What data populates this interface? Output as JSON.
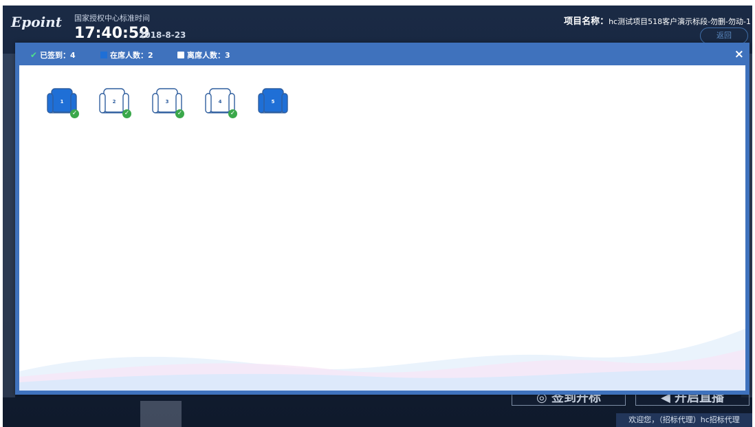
{
  "header": {
    "logo": "Epoint",
    "time_label": "国家授权中心标准时间",
    "time": "17:40:59",
    "date": "2018-8-23",
    "project_label": "项目名称：",
    "project_name": "hc测试项目518客户演示标段-勿删-勿动-1",
    "back_label": "返回"
  },
  "footer": {
    "btn_left": "◎ 签到开标",
    "btn_right": "◀ 开启直播",
    "welcome": "欢迎您，（招标代理）hc招标代理"
  },
  "modal": {
    "legend": {
      "signed_label": "已签到：4",
      "present_label": "在席人数：2",
      "absent_label": "离席人数：3"
    },
    "close_icon": "×"
  },
  "seats": [
    {
      "number": "1",
      "status": "present",
      "signed": true
    },
    {
      "number": "2",
      "status": "absent",
      "signed": true
    },
    {
      "number": "3",
      "status": "absent",
      "signed": true
    },
    {
      "number": "4",
      "status": "absent",
      "signed": true
    },
    {
      "number": "5",
      "status": "present",
      "signed": false
    }
  ],
  "colors": {
    "modal_header": "#3f72bd",
    "seat_present": "#1f6fd6",
    "seat_outline": "#2f5e9e",
    "check": "#3aa84a",
    "background": "#152238"
  }
}
